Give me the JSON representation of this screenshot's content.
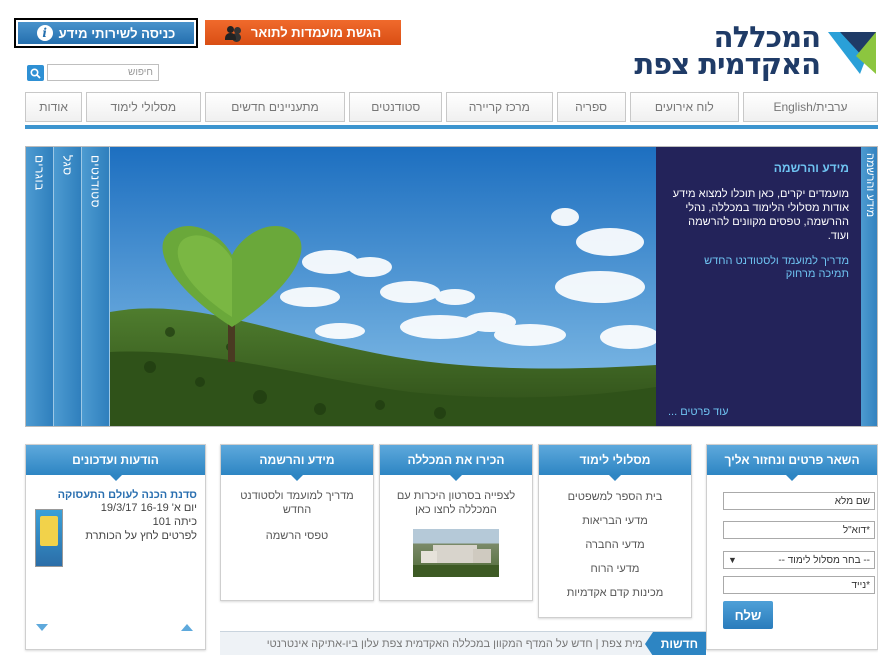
{
  "header": {
    "logo_line1": "המכללה",
    "logo_line2": "האקדמית צפת",
    "visitors_button": "כניסה לשירותי מידע",
    "degree_button": "הגשת מועמדות לתואר",
    "search_placeholder": "חיפוש"
  },
  "nav": {
    "items": [
      "אודות",
      "מסלולי לימוד",
      "מתעניינים חדשים",
      "סטודנטים",
      "מרכז קריירה",
      "ספריה",
      "לוח אירועים",
      "ערבית/English"
    ]
  },
  "hero": {
    "tabs": [
      "סטודנטים",
      "סגל",
      "בוגרים"
    ],
    "side_tab": "מידע והרשמה",
    "panel_title": "מידע והרשמה",
    "panel_body": "מועמדים יקרים, כאן תוכלו למצוא מידע אודות מסלולי הלימוד במכללה, נהלי ההרשמה, טפסים מקוונים להרשמה ועוד.",
    "panel_link1": "מדריך למועמד ולסטודנט החדש",
    "panel_link2": "תמיכה מרחוק",
    "panel_more": "עוד פרטים ..."
  },
  "contact": {
    "title": "השאר פרטים ונחזור אליך",
    "name_value": "שם מלא",
    "email_value": "*דוא\"ל",
    "track_select": "-- בחר מסלול לימוד --",
    "phone_value": "*נייד",
    "send": "שלח"
  },
  "tracks": {
    "title": "מסלולי לימוד",
    "items": [
      "בית הספר למשפטים",
      "מדעי הבריאות",
      "מדעי החברה",
      "מדעי הרוח",
      "מכינות קדם אקדמיות"
    ]
  },
  "about": {
    "title": "הכירו את המכללה",
    "link": "לצפייה בסרטון היכרות עם המכללה לחצו כאן"
  },
  "info": {
    "title": "מידע והרשמה",
    "link1": "מדריך למועמד ולסטודנט החדש",
    "link2": "טפסי הרשמה"
  },
  "updates": {
    "title": "הודעות ועדכונים",
    "item_title": "סדנת הכנה לעולם התעסוקה",
    "item_date": "יום א' 16-19 19/3/17",
    "item_room": "כיתה 101",
    "item_more": "לפרטים לחץ על הכותרת"
  },
  "newsbar": {
    "label": "חדשות",
    "text": "מית צפת  |  חדש על המדף המקוון במכללה האקדמית צפת עלון ביו-אתיקה אינטרנטי"
  },
  "colors": {
    "brand_blue": "#2d85c3",
    "brand_orange": "#e05a1c",
    "panel_navy": "#23235a"
  }
}
